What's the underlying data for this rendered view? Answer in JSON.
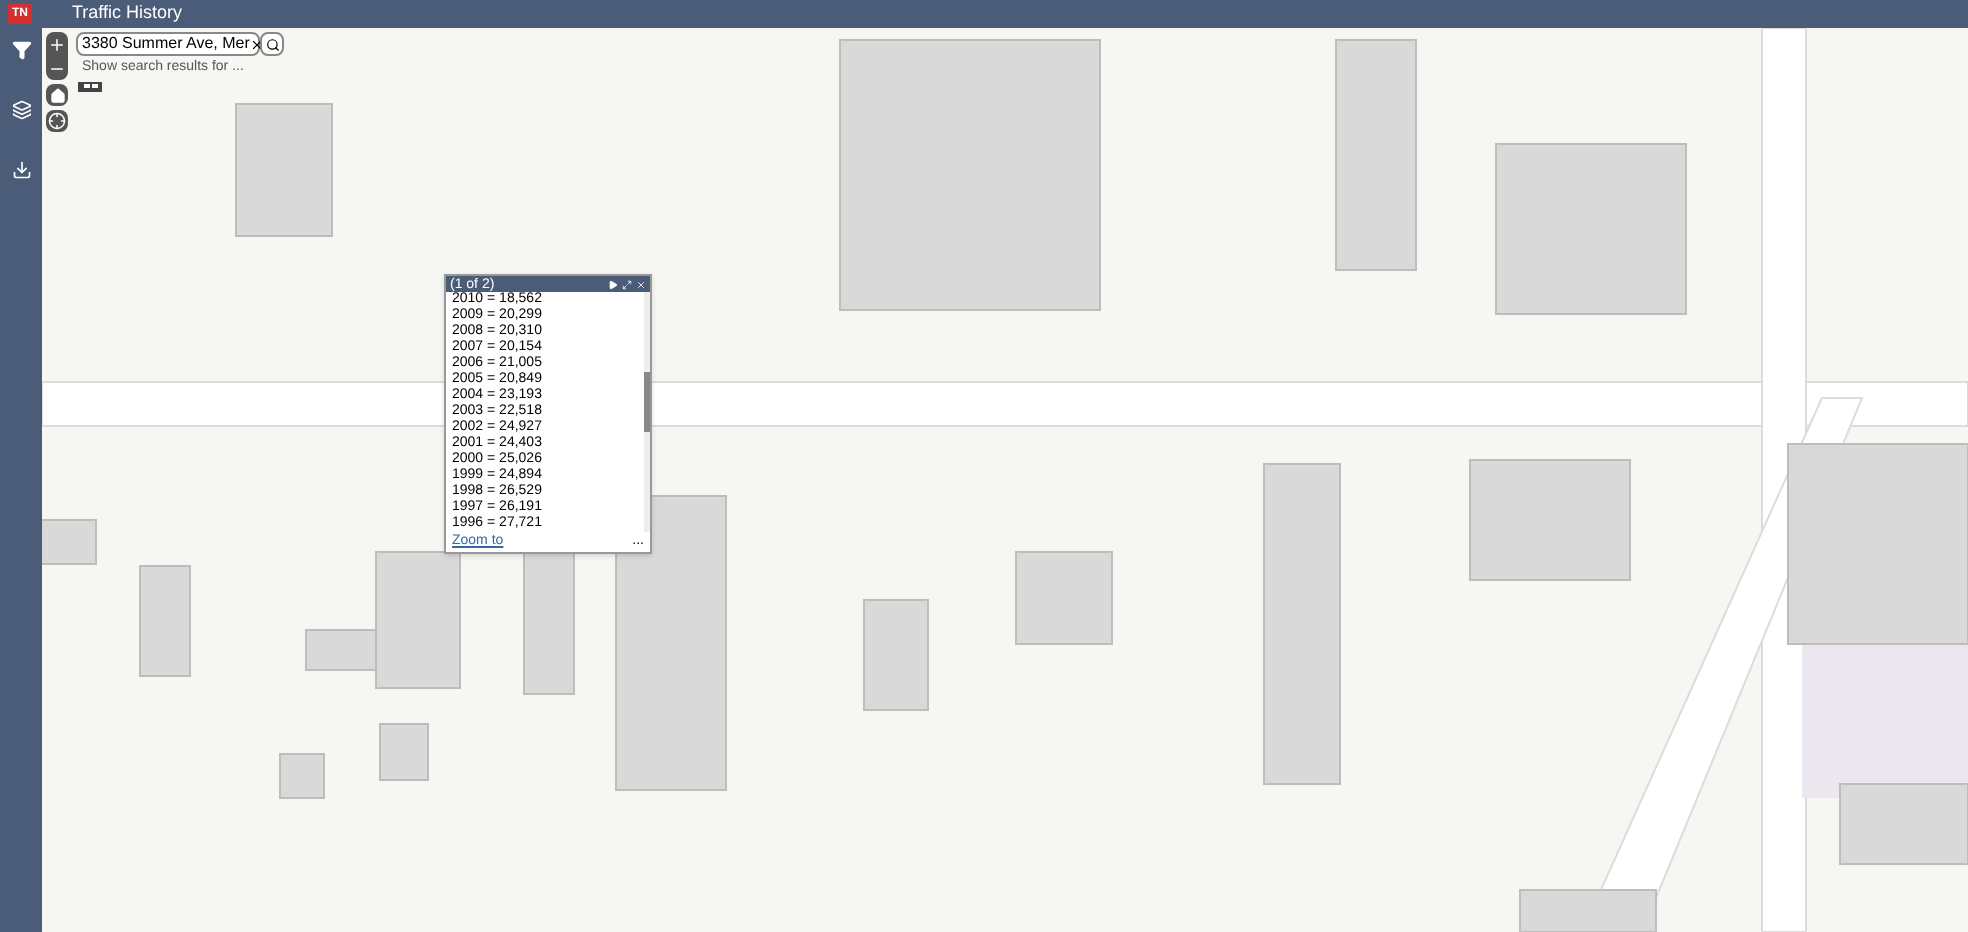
{
  "header": {
    "logo": "TN",
    "title": "Traffic History"
  },
  "search": {
    "value": "3380 Summer Ave, Mer",
    "hint": "Show search results for ..."
  },
  "popup": {
    "title": "(1 of 2)",
    "rows": [
      "2010 = 18,562",
      "2009 = 20,299",
      "2008 = 20,310",
      "2007 = 20,154",
      "2006 = 21,005",
      "2005 = 20,849",
      "2004 = 23,193",
      "2003 = 22,518",
      "2002 = 24,927",
      "2001 = 24,403",
      "2000 = 25,026",
      "1999 = 24,894",
      "1998 = 26,529",
      "1997 = 26,191",
      "1996 = 27,721"
    ],
    "link": "Zoom to",
    "more": "..."
  }
}
